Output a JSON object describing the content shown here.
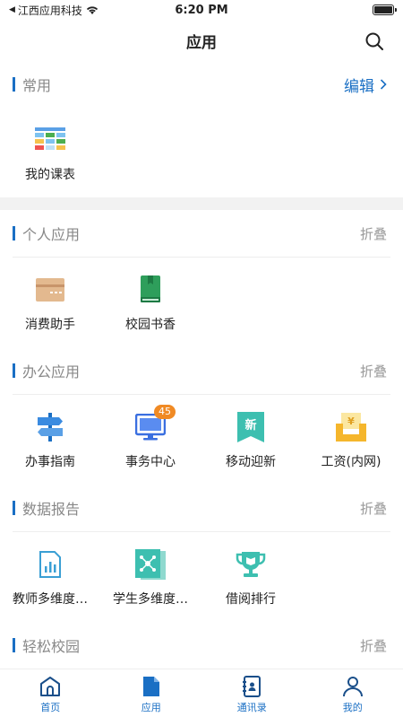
{
  "status": {
    "carrier": "江西应用科技",
    "time": "6:20 PM"
  },
  "header": {
    "title": "应用"
  },
  "sections": {
    "common": {
      "title": "常用",
      "action": "编辑",
      "apps": [
        {
          "label": "我的课表"
        }
      ]
    },
    "personal": {
      "title": "个人应用",
      "action": "折叠",
      "apps": [
        {
          "label": "消费助手"
        },
        {
          "label": "校园书香"
        }
      ]
    },
    "office": {
      "title": "办公应用",
      "action": "折叠",
      "apps": [
        {
          "label": "办事指南"
        },
        {
          "label": "事务中心",
          "badge": "45"
        },
        {
          "label": "移动迎新"
        },
        {
          "label": "工资(内网)"
        }
      ]
    },
    "reports": {
      "title": "数据报告",
      "action": "折叠",
      "apps": [
        {
          "label": "教师多维度…"
        },
        {
          "label": "学生多维度…"
        },
        {
          "label": "借阅排行"
        }
      ]
    },
    "campus": {
      "title": "轻松校园",
      "action": "折叠"
    }
  },
  "icons": {
    "xin_glyph": "新",
    "yen_glyph": "¥"
  },
  "tabs": [
    {
      "label": "首页"
    },
    {
      "label": "应用"
    },
    {
      "label": "通讯录"
    },
    {
      "label": "我的"
    }
  ],
  "colors": {
    "accent": "#1a6fc4",
    "badge": "#f08a24",
    "teal": "#3dbfb0"
  }
}
